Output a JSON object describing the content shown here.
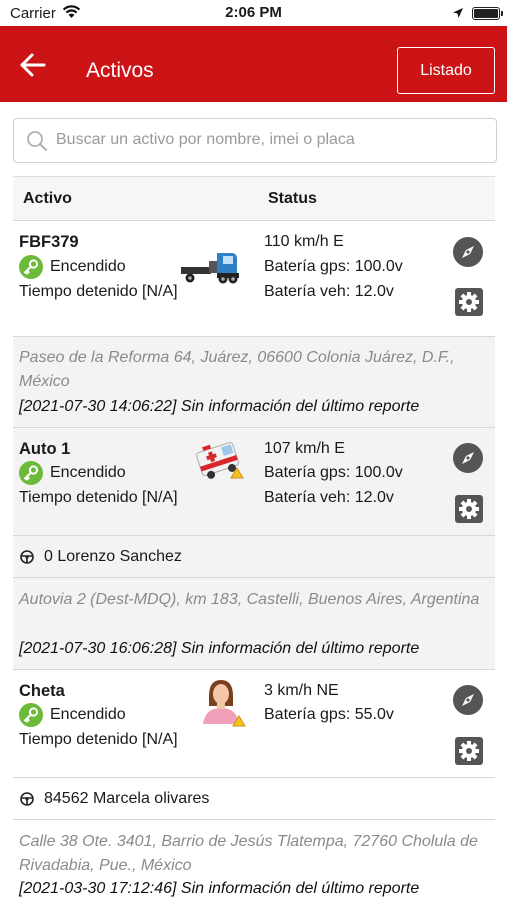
{
  "status_bar": {
    "carrier": "Carrier",
    "time": "2:06 PM",
    "wifi_icon": "wifi-icon",
    "location_icon": "location-arrow-icon",
    "battery_icon": "battery-icon"
  },
  "header": {
    "title": "Activos",
    "listado_label": "Listado",
    "background": "#cc1417"
  },
  "search": {
    "placeholder": "Buscar un activo por nombre, imei o placa",
    "value": ""
  },
  "table": {
    "col_activo": "Activo",
    "col_status": "Status"
  },
  "assets": [
    {
      "name": "FBF379",
      "state": "Encendido",
      "stopped": "Tiempo detenido [N/A]",
      "icon": "tow-truck-icon",
      "speed": "110 km/h E",
      "battery_gps": "Batería gps: 100.0v",
      "battery_veh": "Batería veh: 12.0v",
      "address": "Paseo de la Reforma 64, Juárez, 06600 Colonia Juárez, D.F., México",
      "report": "[2021-07-30 14:06:22] Sin información del último reporte"
    },
    {
      "name": "Auto 1",
      "state": "Encendido",
      "stopped": "Tiempo detenido [N/A]",
      "icon": "ambulance-icon",
      "speed": "107 km/h E",
      "battery_gps": "Batería gps: 100.0v",
      "battery_veh": "Batería veh: 12.0v",
      "driver": "0 Lorenzo Sanchez",
      "address": "Autovia 2 (Dest-MDQ), km 183, Castelli, Buenos Aires, Argentina",
      "report": "[2021-07-30 16:06:28] Sin información del último reporte"
    },
    {
      "name": "Cheta",
      "state": "Encendido",
      "stopped": "Tiempo detenido [N/A]",
      "icon": "person-icon",
      "speed": "3 km/h NE",
      "battery_gps": "Batería gps: 55.0v",
      "driver": "84562 Marcela olivares",
      "address": "Calle 38 Ote. 3401, Barrio de Jesús Tlatempa, 72760 Cholula de Rivadabia, Pue., México",
      "report": "[2021-03-30 17:12:46] Sin información del último reporte"
    }
  ],
  "colors": {
    "ignition_on": "#6cba3a",
    "action_icon": "#555555"
  }
}
